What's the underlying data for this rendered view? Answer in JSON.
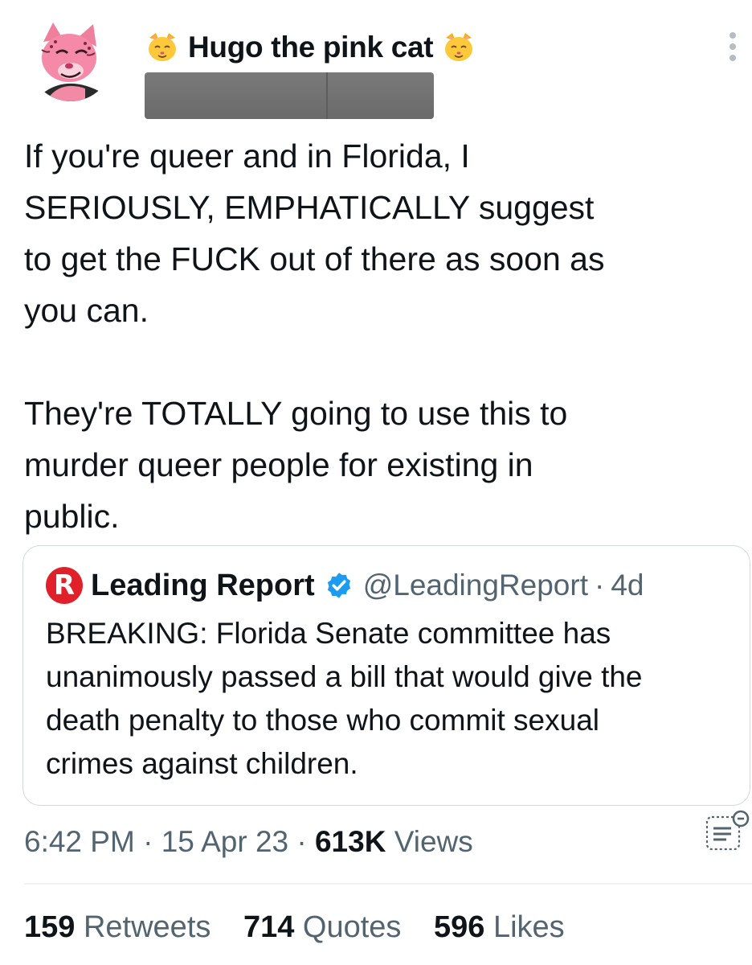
{
  "author": {
    "display_name": "Hugo the pink cat",
    "name_emoji": "cat-face-emoji",
    "avatar": "pink-cat-avatar",
    "handle_redacted": true
  },
  "tweet": {
    "text": "If you're queer and in Florida, I\nSERIOUSLY, EMPHATICALLY suggest\nto get the FUCK out of there as soon as\nyou can.\n\nThey're TOTALLY going to use this to\nmurder queer people for existing in\npublic."
  },
  "quote": {
    "avatar_letter": "R",
    "name": "Leading Report",
    "verified_icon": "verified-badge-icon",
    "handle": "@LeadingReport",
    "separator": "·",
    "age": "4d",
    "text": "BREAKING: Florida Senate committee has\nunanimously passed a bill that would give the\ndeath penalty to those who commit sexual\ncrimes against children."
  },
  "meta": {
    "time": "6:42 PM",
    "sep1": " · ",
    "date": "15 Apr 23",
    "sep2": " · ",
    "views_count": "613K",
    "views_label": " Views"
  },
  "stats": {
    "retweets_count": "159",
    "retweets_label": "Retweets",
    "quotes_count": "714",
    "quotes_label": "Quotes",
    "likes_count": "596",
    "likes_label": "Likes"
  },
  "colors": {
    "text": "#0f1419",
    "secondary": "#536471",
    "verified": "#1d9bf0",
    "brand_red": "#e0212a"
  }
}
